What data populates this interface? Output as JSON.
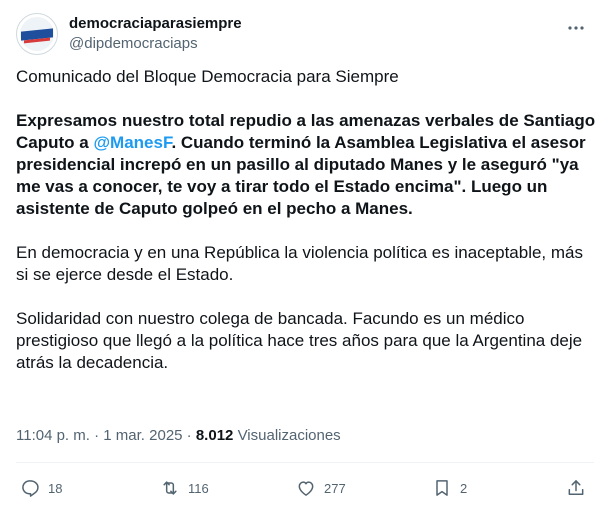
{
  "author": {
    "display_name": "democraciaparasiempre",
    "handle": "@dipdemocraciaps"
  },
  "tweet": {
    "intro": "Comunicado del Bloque Democracia para Siempre",
    "bold_before_mention": "Expresamos nuestro total repudio a las amenazas verbales de Santiago Caputo a ",
    "mention": "@ManesF",
    "bold_after_mention": ". Cuando terminó la Asamblea Legislativa el asesor presidencial increpó en un pasillo al diputado Manes y le aseguró \"ya me vas a conocer, te voy a tirar todo el Estado encima\". Luego un asistente de Caputo golpeó en el pecho a Manes.",
    "paragraph_3": "En democracia y en una República la violencia política es inaceptable, más si se ejerce desde el Estado.",
    "paragraph_4": "Solidaridad con nuestro colega de bancada. Facundo es un médico prestigioso que llegó a la política hace tres años para que la Argentina deje atrás la decadencia."
  },
  "meta": {
    "time": "11:04 p. m.",
    "separator": "·",
    "date": "1 mar. 2025",
    "views_count": "8.012",
    "views_label": "Visualizaciones"
  },
  "actions": {
    "replies": "18",
    "reposts": "116",
    "likes": "277",
    "bookmarks": "2"
  },
  "colors": {
    "text": "#0f1419",
    "secondary": "#536471",
    "link": "#1d9bf0",
    "divider": "#eff3f4"
  },
  "icons": [
    "more-icon",
    "reply-icon",
    "repost-icon",
    "like-icon",
    "bookmark-icon",
    "share-icon"
  ]
}
